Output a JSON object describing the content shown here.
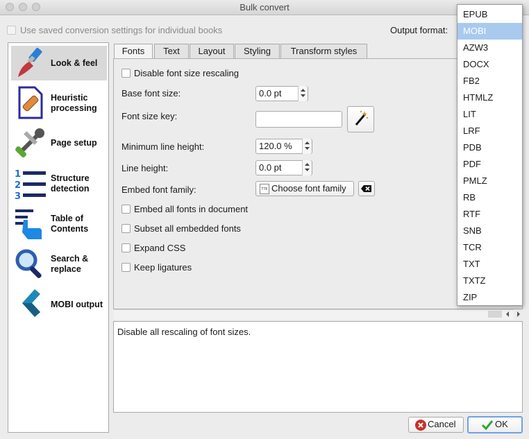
{
  "window": {
    "title": "Bulk convert"
  },
  "top": {
    "saved_settings_label": "Use saved conversion settings for individual books",
    "output_format_label": "Output format:"
  },
  "sidebar": {
    "items": [
      {
        "label": "Look & feel",
        "icon": "paintbrush-icon"
      },
      {
        "label": "Heuristic\nprocessing",
        "icon": "document-bandage-icon"
      },
      {
        "label": "Page setup",
        "icon": "wrench-screwdriver-icon"
      },
      {
        "label": "Structure\ndetection",
        "icon": "numbered-list-icon"
      },
      {
        "label": "Table of\nContents",
        "icon": "toc-pointer-icon"
      },
      {
        "label": "Search &\nreplace",
        "icon": "magnifier-icon"
      },
      {
        "label": "MOBI output",
        "icon": "chevron-left-icon"
      }
    ]
  },
  "tabs": [
    "Fonts",
    "Text",
    "Layout",
    "Styling",
    "Transform styles"
  ],
  "fonts_tab": {
    "disable_rescaling_label": "Disable font size rescaling",
    "base_font_size_label": "Base font size:",
    "base_font_size_value": "0.0 pt",
    "font_size_key_label": "Font size key:",
    "font_size_key_value": "",
    "min_line_height_label": "Minimum line height:",
    "min_line_height_value": "120.0 %",
    "line_height_label": "Line height:",
    "line_height_value": "0.0 pt",
    "embed_font_family_label": "Embed font family:",
    "choose_font_family_button": "Choose font family",
    "embed_all_fonts_label": "Embed all fonts in document",
    "subset_fonts_label": "Subset all embedded fonts",
    "expand_css_label": "Expand CSS",
    "keep_ligatures_label": "Keep ligatures"
  },
  "description": "Disable all rescaling of font sizes.",
  "buttons": {
    "cancel": "Cancel",
    "ok": "OK"
  },
  "output_format_dropdown": {
    "selected": "MOBI",
    "options": [
      "EPUB",
      "MOBI",
      "AZW3",
      "DOCX",
      "FB2",
      "HTMLZ",
      "LIT",
      "LRF",
      "PDB",
      "PDF",
      "PMLZ",
      "RB",
      "RTF",
      "SNB",
      "TCR",
      "TXT",
      "TXTZ",
      "ZIP"
    ]
  },
  "colors": {
    "selection": "#a9c9ef",
    "ok_green": "#2fa52f",
    "cancel_red": "#c8312b"
  }
}
